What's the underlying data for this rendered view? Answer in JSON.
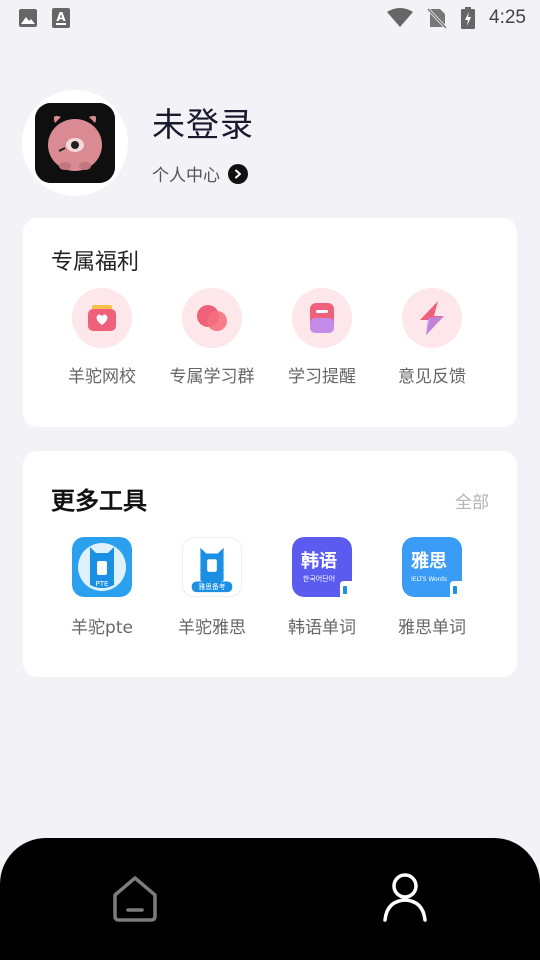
{
  "status_bar": {
    "time": "4:25",
    "left_icons": [
      "image-icon",
      "text-a-icon"
    ],
    "right_icons": [
      "wifi-icon",
      "no-sim-icon",
      "battery-charging-icon"
    ]
  },
  "profile": {
    "username": "未登录",
    "personal_center_label": "个人中心"
  },
  "benefits": {
    "title": "专属福利",
    "items": [
      {
        "label": "羊驼网校",
        "icon": "heart-box-icon"
      },
      {
        "label": "专属学习群",
        "icon": "group-bubbles-icon"
      },
      {
        "label": "学习提醒",
        "icon": "reminder-notebook-icon"
      },
      {
        "label": "意见反馈",
        "icon": "lightning-feedback-icon"
      }
    ]
  },
  "tools": {
    "title": "更多工具",
    "see_all_label": "全部",
    "items": [
      {
        "label": "羊驼pte",
        "icon": "pte-app-icon",
        "badge": "PTE"
      },
      {
        "label": "羊驼雅思",
        "icon": "ielts-app-icon",
        "badge": "雅思备考"
      },
      {
        "label": "韩语单词",
        "icon": "korean-words-app-icon",
        "main": "韩语",
        "sub": "한국어단어"
      },
      {
        "label": "雅思单词",
        "icon": "ielts-words-app-icon",
        "main": "雅思",
        "sub": "IELTS Words"
      }
    ]
  },
  "bottom_nav": {
    "items": [
      {
        "name": "home",
        "icon": "home-icon"
      },
      {
        "name": "profile",
        "icon": "profile-icon"
      }
    ]
  },
  "colors": {
    "background": "#f3f2f6",
    "card": "#ffffff",
    "benefit_circle": "#fde7ea",
    "accent_pink": "#f0607a",
    "nav_bg": "#000000"
  }
}
